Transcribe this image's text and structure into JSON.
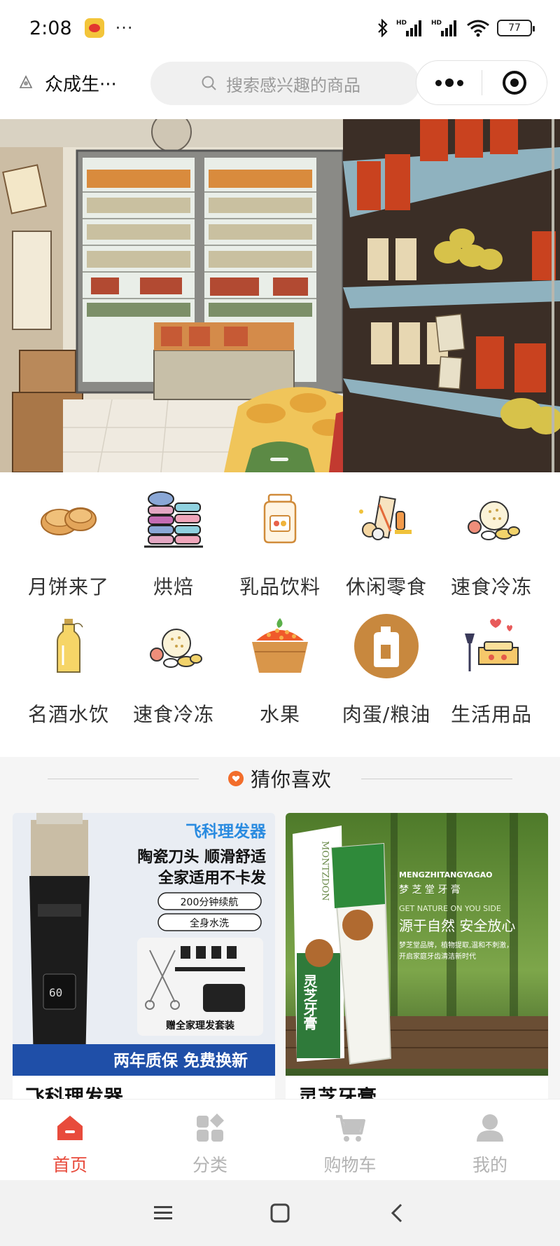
{
  "status_bar": {
    "time": "2:08",
    "app_icon": "weibo-icon",
    "more": "···",
    "network_label_1": "HD",
    "network_label_2": "HD",
    "battery": "77"
  },
  "header": {
    "store_name": "众成生···",
    "search_placeholder": "搜索感兴趣的商品",
    "more_icon": "more-dots-icon",
    "close_icon": "target-close-icon"
  },
  "banner": {
    "image": "grocery-store-illustration",
    "slide_index": 1
  },
  "categories": [
    {
      "label": "月饼来了",
      "icon": "mooncake-icon"
    },
    {
      "label": "烘焙",
      "icon": "macaron-icon"
    },
    {
      "label": "乳品饮料",
      "icon": "milk-jar-icon"
    },
    {
      "label": "休闲零食",
      "icon": "snacks-icon"
    },
    {
      "label": "速食冷冻",
      "icon": "frozen-food-icon"
    },
    {
      "label": "名酒水饮",
      "icon": "liquor-bottle-icon"
    },
    {
      "label": "速食冷冻",
      "icon": "frozen-food-icon"
    },
    {
      "label": "水果",
      "icon": "fruit-basket-icon"
    },
    {
      "label": "肉蛋/粮油",
      "icon": "oil-jug-icon"
    },
    {
      "label": "生活用品",
      "icon": "home-goods-icon"
    }
  ],
  "recommend": {
    "title": "猜你喜欢",
    "icon": "heart-icon"
  },
  "products": [
    {
      "name": "飞科理发器",
      "image_texts": {
        "brand": "飞科理发器",
        "line1": "陶瓷刀头 顺滑舒适",
        "line2": "全家适用不卡发",
        "pill1": "200分钟续航",
        "pill2": "全身水洗",
        "gift": "赠全家理发套装",
        "footer": "两年质保 免费换新"
      }
    },
    {
      "name": "灵芝牙膏",
      "image_texts": {
        "brand_en": "MENGZHITANGYAGAO",
        "brand_cn": "梦 芝 堂 牙 膏",
        "slogan_en": "GET NATURE ON YOU SIDE",
        "slogan_cn": "源于自然 安全放心",
        "desc1": "梦芝堂品牌，植物提取,温和不刺激，",
        "desc2": "开启家庭牙齿清洁新时代",
        "box_text": "灵芝牙膏",
        "box_brand": "MONTZDON"
      }
    }
  ],
  "tabbar": [
    {
      "label": "首页",
      "icon": "home-icon",
      "active": true
    },
    {
      "label": "分类",
      "icon": "category-icon",
      "active": false
    },
    {
      "label": "购物车",
      "icon": "cart-icon",
      "active": false
    },
    {
      "label": "我的",
      "icon": "profile-icon",
      "active": false
    }
  ],
  "colors": {
    "accent": "#e84b3c",
    "tab_inactive": "#b3b3b3",
    "heart": "#f26d2b"
  }
}
